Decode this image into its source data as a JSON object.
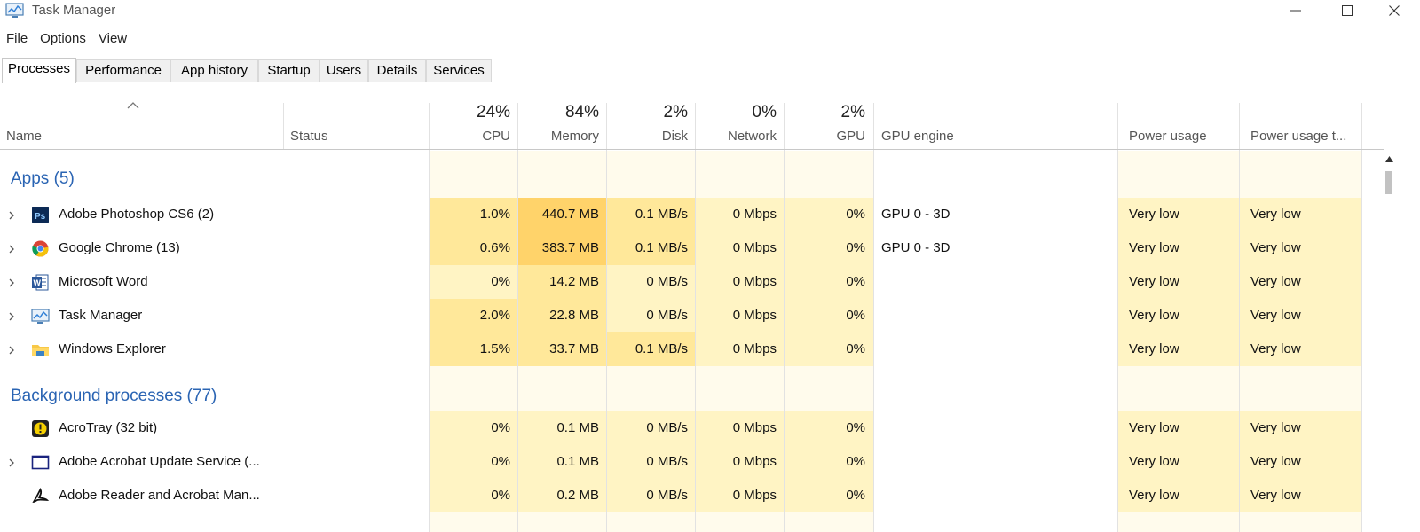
{
  "window": {
    "title": "Task Manager"
  },
  "menu": [
    "File",
    "Options",
    "View"
  ],
  "tabs": [
    "Processes",
    "Performance",
    "App history",
    "Startup",
    "Users",
    "Details",
    "Services"
  ],
  "active_tab": "Processes",
  "columns": {
    "name": "Name",
    "status": "Status",
    "cpu": {
      "pct": "24%",
      "label": "CPU"
    },
    "memory": {
      "pct": "84%",
      "label": "Memory"
    },
    "disk": {
      "pct": "2%",
      "label": "Disk"
    },
    "network": {
      "pct": "0%",
      "label": "Network"
    },
    "gpu": {
      "pct": "2%",
      "label": "GPU"
    },
    "gpu_engine": "GPU engine",
    "power": "Power usage",
    "power_trend": "Power usage t..."
  },
  "groups": {
    "apps": "Apps (5)",
    "background": "Background processes (77)"
  },
  "apps": [
    {
      "name": "Adobe Photoshop CS6 (2)",
      "icon": "photoshop-icon",
      "cpu": "1.0%",
      "memory": "440.7 MB",
      "disk": "0.1 MB/s",
      "network": "0 Mbps",
      "gpu": "0%",
      "gpu_engine": "GPU 0 - 3D",
      "power": "Very low",
      "power_trend": "Very low"
    },
    {
      "name": "Google Chrome (13)",
      "icon": "chrome-icon",
      "cpu": "0.6%",
      "memory": "383.7 MB",
      "disk": "0.1 MB/s",
      "network": "0 Mbps",
      "gpu": "0%",
      "gpu_engine": "GPU 0 - 3D",
      "power": "Very low",
      "power_trend": "Very low"
    },
    {
      "name": "Microsoft Word",
      "icon": "word-icon",
      "cpu": "0%",
      "memory": "14.2 MB",
      "disk": "0 MB/s",
      "network": "0 Mbps",
      "gpu": "0%",
      "gpu_engine": "",
      "power": "Very low",
      "power_trend": "Very low"
    },
    {
      "name": "Task Manager",
      "icon": "task-manager-icon",
      "cpu": "2.0%",
      "memory": "22.8 MB",
      "disk": "0 MB/s",
      "network": "0 Mbps",
      "gpu": "0%",
      "gpu_engine": "",
      "power": "Very low",
      "power_trend": "Very low"
    },
    {
      "name": "Windows Explorer",
      "icon": "folder-icon",
      "cpu": "1.5%",
      "memory": "33.7 MB",
      "disk": "0.1 MB/s",
      "network": "0 Mbps",
      "gpu": "0%",
      "gpu_engine": "",
      "power": "Very low",
      "power_trend": "Very low"
    }
  ],
  "background": [
    {
      "name": "AcroTray (32 bit)",
      "icon": "acrotray-icon",
      "cpu": "0%",
      "memory": "0.1 MB",
      "disk": "0 MB/s",
      "network": "0 Mbps",
      "gpu": "0%",
      "gpu_engine": "",
      "power": "Very low",
      "power_trend": "Very low"
    },
    {
      "name": "Adobe Acrobat Update Service (...",
      "icon": "service-window-icon",
      "cpu": "0%",
      "memory": "0.1 MB",
      "disk": "0 MB/s",
      "network": "0 Mbps",
      "gpu": "0%",
      "gpu_engine": "",
      "power": "Very low",
      "power_trend": "Very low"
    },
    {
      "name": "Adobe Reader and Acrobat Man...",
      "icon": "acrobat-icon",
      "cpu": "0%",
      "memory": "0.2 MB",
      "disk": "0 MB/s",
      "network": "0 Mbps",
      "gpu": "0%",
      "gpu_engine": "",
      "power": "Very low",
      "power_trend": "Very low"
    }
  ],
  "colors": {
    "heat_light": "#fff4c4",
    "heat_mid": "#ffe89a",
    "heat_high": "#ffd36a",
    "heat_empty": "#fffbec",
    "group_blue": "#2a64b3"
  }
}
